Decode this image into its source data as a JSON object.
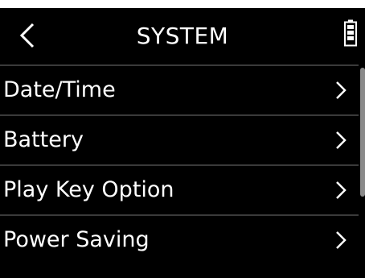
{
  "header": {
    "title": "SYSTEM",
    "back_icon": "chevron-left-icon",
    "battery_icon": "battery-icon"
  },
  "menu": {
    "items": [
      {
        "label": "Date/Time",
        "icon": "chevron-right-icon"
      },
      {
        "label": "Battery",
        "icon": "chevron-right-icon"
      },
      {
        "label": "Play Key Option",
        "icon": "chevron-right-icon"
      },
      {
        "label": "Power Saving",
        "icon": "chevron-right-icon"
      }
    ]
  },
  "colors": {
    "background": "#000000",
    "text": "#ffffff",
    "divider": "#3a3a3a",
    "scrollbar": "#8a8a8a"
  }
}
